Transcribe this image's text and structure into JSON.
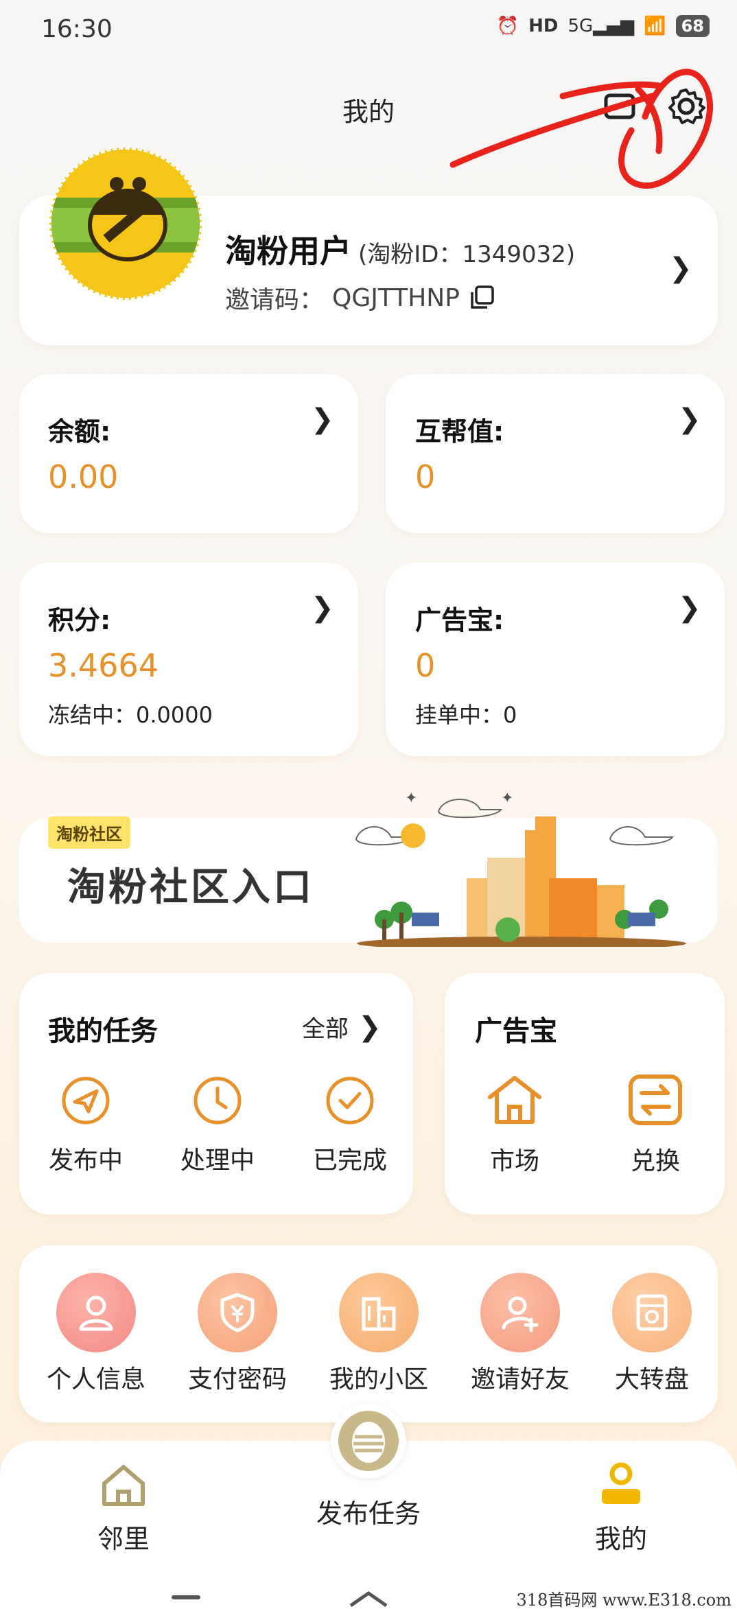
{
  "status_bar": {
    "time": "16:30",
    "signal": "5G",
    "hd": "HD",
    "battery": "68"
  },
  "header": {
    "title": "我的"
  },
  "profile": {
    "name": "淘粉用户",
    "id_text": "(淘粉ID：1349032)",
    "invite_label": "邀请码：",
    "invite_code": "QGJTTHNP"
  },
  "stats": {
    "balance": {
      "title": "余额:",
      "value": "0.00"
    },
    "help": {
      "title": "互帮值:",
      "value": "0"
    },
    "points": {
      "title": "积分:",
      "value": "3.4664",
      "sub": "冻结中：0.0000"
    },
    "ads": {
      "title": "广告宝:",
      "value": "0",
      "sub": "挂单中：0"
    }
  },
  "banner": {
    "tag": "淘粉社区",
    "title": "淘粉社区入口"
  },
  "tasks": {
    "title": "我的任务",
    "all_label": "全部",
    "items": [
      {
        "label": "发布中",
        "icon": "send-icon"
      },
      {
        "label": "处理中",
        "icon": "clock-icon"
      },
      {
        "label": "已完成",
        "icon": "check-icon"
      }
    ]
  },
  "adbao": {
    "title": "广告宝",
    "items": [
      {
        "label": "市场",
        "icon": "home-icon"
      },
      {
        "label": "兑换",
        "icon": "exchange-icon"
      }
    ]
  },
  "tools": [
    {
      "label": "个人信息",
      "icon": "user-icon"
    },
    {
      "label": "支付密码",
      "icon": "shield-yen-icon"
    },
    {
      "label": "我的小区",
      "icon": "building-icon"
    },
    {
      "label": "邀请好友",
      "icon": "add-user-icon"
    },
    {
      "label": "大转盘",
      "icon": "wheel-icon"
    }
  ],
  "nav": [
    {
      "label": "邻里",
      "icon": "house-icon"
    },
    {
      "label": "发布任务",
      "icon": "publish-icon"
    },
    {
      "label": "我的",
      "icon": "profile-icon"
    }
  ],
  "watermark": "318首码网 www.E318.com",
  "colors": {
    "accent": "#e8912a",
    "nav_active": "#f2b705"
  }
}
